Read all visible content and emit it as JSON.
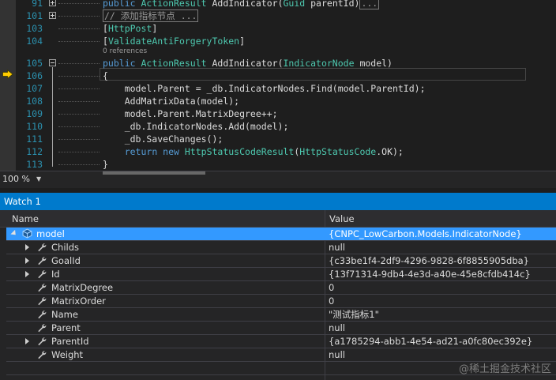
{
  "editor": {
    "lines": [
      {
        "num": "91",
        "fold": "plus",
        "parts": [
          {
            "t": "public ",
            "c": "kw"
          },
          {
            "t": "ActionResult",
            "c": "ty"
          },
          {
            "t": " AddIndicator(",
            "c": ""
          },
          {
            "t": "Guid",
            "c": "ty"
          },
          {
            "t": " parentId)",
            "c": ""
          },
          {
            "t": "...",
            "c": "box"
          }
        ]
      },
      {
        "num": "101",
        "fold": "plus",
        "parts": [
          {
            "t": "// 添加指标节点 ...",
            "c": "cm box"
          }
        ]
      },
      {
        "num": "103",
        "fold": "",
        "parts": [
          {
            "t": "[",
            "c": ""
          },
          {
            "t": "HttpPost",
            "c": "ty"
          },
          {
            "t": "]",
            "c": ""
          }
        ]
      },
      {
        "num": "104",
        "fold": "",
        "parts": [
          {
            "t": "[",
            "c": ""
          },
          {
            "t": "ValidateAntiForgeryToken",
            "c": "ty"
          },
          {
            "t": "]",
            "c": ""
          }
        ]
      },
      {
        "num": "105",
        "fold": "minus",
        "parts": [
          {
            "t": "public ",
            "c": "kw"
          },
          {
            "t": "ActionResult",
            "c": "ty"
          },
          {
            "t": " AddIndicator(",
            "c": ""
          },
          {
            "t": "IndicatorNode",
            "c": "ty"
          },
          {
            "t": " model)",
            "c": ""
          }
        ]
      },
      {
        "num": "106",
        "fold": "",
        "parts": [
          {
            "t": "{",
            "c": ""
          }
        ]
      },
      {
        "num": "107",
        "fold": "",
        "parts": [
          {
            "t": "    model.Parent = _db.IndicatorNodes.Find(model.ParentId);",
            "c": ""
          }
        ]
      },
      {
        "num": "108",
        "fold": "",
        "parts": [
          {
            "t": "    AddMatrixData(model);",
            "c": ""
          }
        ]
      },
      {
        "num": "109",
        "fold": "",
        "parts": [
          {
            "t": "    model.Parent.MatrixDegree++;",
            "c": ""
          }
        ]
      },
      {
        "num": "110",
        "fold": "",
        "parts": [
          {
            "t": "    _db.IndicatorNodes.Add(model);",
            "c": ""
          }
        ]
      },
      {
        "num": "111",
        "fold": "",
        "parts": [
          {
            "t": "    _db.SaveChanges();",
            "c": ""
          }
        ]
      },
      {
        "num": "112",
        "fold": "",
        "parts": [
          {
            "t": "    ",
            "c": ""
          },
          {
            "t": "return new ",
            "c": "kw"
          },
          {
            "t": "HttpStatusCodeResult",
            "c": "ty"
          },
          {
            "t": "(",
            "c": ""
          },
          {
            "t": "HttpStatusCode",
            "c": "ty"
          },
          {
            "t": ".OK);",
            "c": ""
          }
        ]
      },
      {
        "num": "113",
        "fold": "",
        "parts": [
          {
            "t": "}",
            "c": ""
          }
        ]
      }
    ],
    "references_label": "0 references",
    "zoom_label": "100 %"
  },
  "watch": {
    "title": "Watch 1",
    "col_name": "Name",
    "col_value": "Value",
    "rows": [
      {
        "name": "model",
        "value": "{CNPC_LowCarbon.Models.IndicatorNode}",
        "icon": "object-icon",
        "expand": "open",
        "level": 0,
        "selected": true
      },
      {
        "name": "Childs",
        "value": "null",
        "icon": "wrench-icon",
        "expand": "closed",
        "level": 1,
        "selected": false
      },
      {
        "name": "GoalId",
        "value": "{c33be1f4-2df9-4296-9828-6f8855905dba}",
        "icon": "wrench-icon",
        "expand": "closed",
        "level": 1,
        "selected": false
      },
      {
        "name": "Id",
        "value": "{13f71314-9db4-4e3d-a40e-45e8cfdb414c}",
        "icon": "wrench-icon",
        "expand": "closed",
        "level": 1,
        "selected": false
      },
      {
        "name": "MatrixDegree",
        "value": "0",
        "icon": "wrench-icon",
        "expand": "none",
        "level": 1,
        "selected": false
      },
      {
        "name": "MatrixOrder",
        "value": "0",
        "icon": "wrench-icon",
        "expand": "none",
        "level": 1,
        "selected": false
      },
      {
        "name": "Name",
        "value": "\"测试指标1\"",
        "icon": "wrench-icon",
        "expand": "none",
        "level": 1,
        "selected": false
      },
      {
        "name": "Parent",
        "value": "null",
        "icon": "wrench-icon",
        "expand": "none",
        "level": 1,
        "selected": false
      },
      {
        "name": "ParentId",
        "value": "{a1785294-abb1-4e54-ad21-a0fc80ec392e}",
        "icon": "wrench-icon",
        "expand": "closed",
        "level": 1,
        "selected": false
      },
      {
        "name": "Weight",
        "value": "null",
        "icon": "wrench-icon",
        "expand": "none",
        "level": 1,
        "selected": false
      }
    ]
  },
  "watermark": "@稀土掘金技术社区",
  "colors": {
    "accent": "#007acc",
    "selection": "#3399ff",
    "keyword": "#569cd6",
    "type": "#4ec9b0",
    "comment": "#57a64a",
    "line_number": "#2b91af"
  }
}
